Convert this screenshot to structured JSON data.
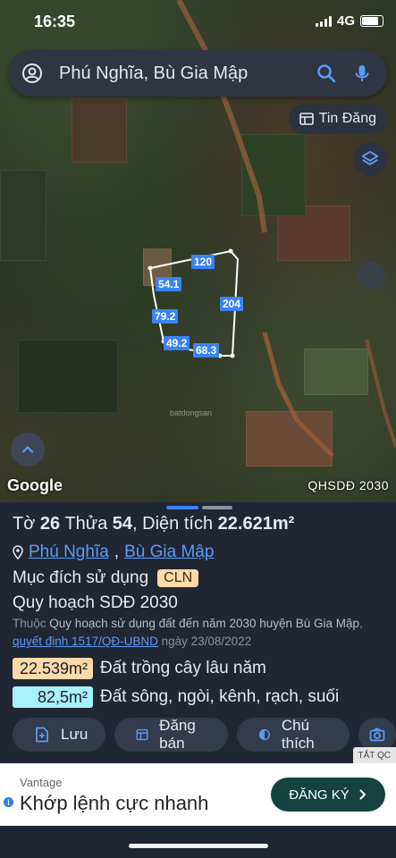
{
  "status": {
    "time": "16:35",
    "network": "4G"
  },
  "search": {
    "query": "Phú Nghĩa, Bù Gia Mập"
  },
  "map": {
    "tin_dang": "Tin Đăng",
    "google": "Google",
    "overlay": "QHSDĐ 2030",
    "edge_labels": [
      "120",
      "54.1",
      "204",
      "79.2",
      "49.2",
      "68.3"
    ],
    "watermark": "batdongsan"
  },
  "parcel": {
    "title_prefix": "Tờ",
    "to": "26",
    "thua_label": "Thửa",
    "thua": "54",
    "area_label": ", Diện tích",
    "area": "22.621m²",
    "commune": "Phú Nghĩa",
    "separator": ",",
    "district": "Bù Gia Mập",
    "purpose_label": "Mục đích sử dụng",
    "purpose_code": "CLN",
    "plan_title": "Quy hoạch SDĐ 2030",
    "desc_prefix": "Thuộc",
    "desc_main": "Quy hoạch sử dụng đất đến năm 2030 huyện Bù Gia Mập",
    "desc_sep": ",",
    "decision": "quyết định 1517/QĐ-UBND",
    "decision_date": "ngày 23/08/2022",
    "breakdown": [
      {
        "area": "22.539m²",
        "label": "Đất trồng cây lâu năm",
        "color": "#fcd9a8"
      },
      {
        "area": "82,5m²",
        "label": "Đất sông, ngòi, kênh, rạch, suối",
        "color": "#a8f0fa"
      }
    ]
  },
  "actions": {
    "save": "Lưu",
    "post": "Đăng bán",
    "legend": "Chú thích"
  },
  "ad": {
    "advertiser": "Vantage",
    "text": "Khớp lệnh cực nhanh",
    "cta": "ĐĂNG KÝ",
    "close": "TẮT QC"
  },
  "colors": {
    "accent": "#5b9cf5",
    "map_label": "#3b82f6",
    "sheet_bg": "#202634"
  }
}
